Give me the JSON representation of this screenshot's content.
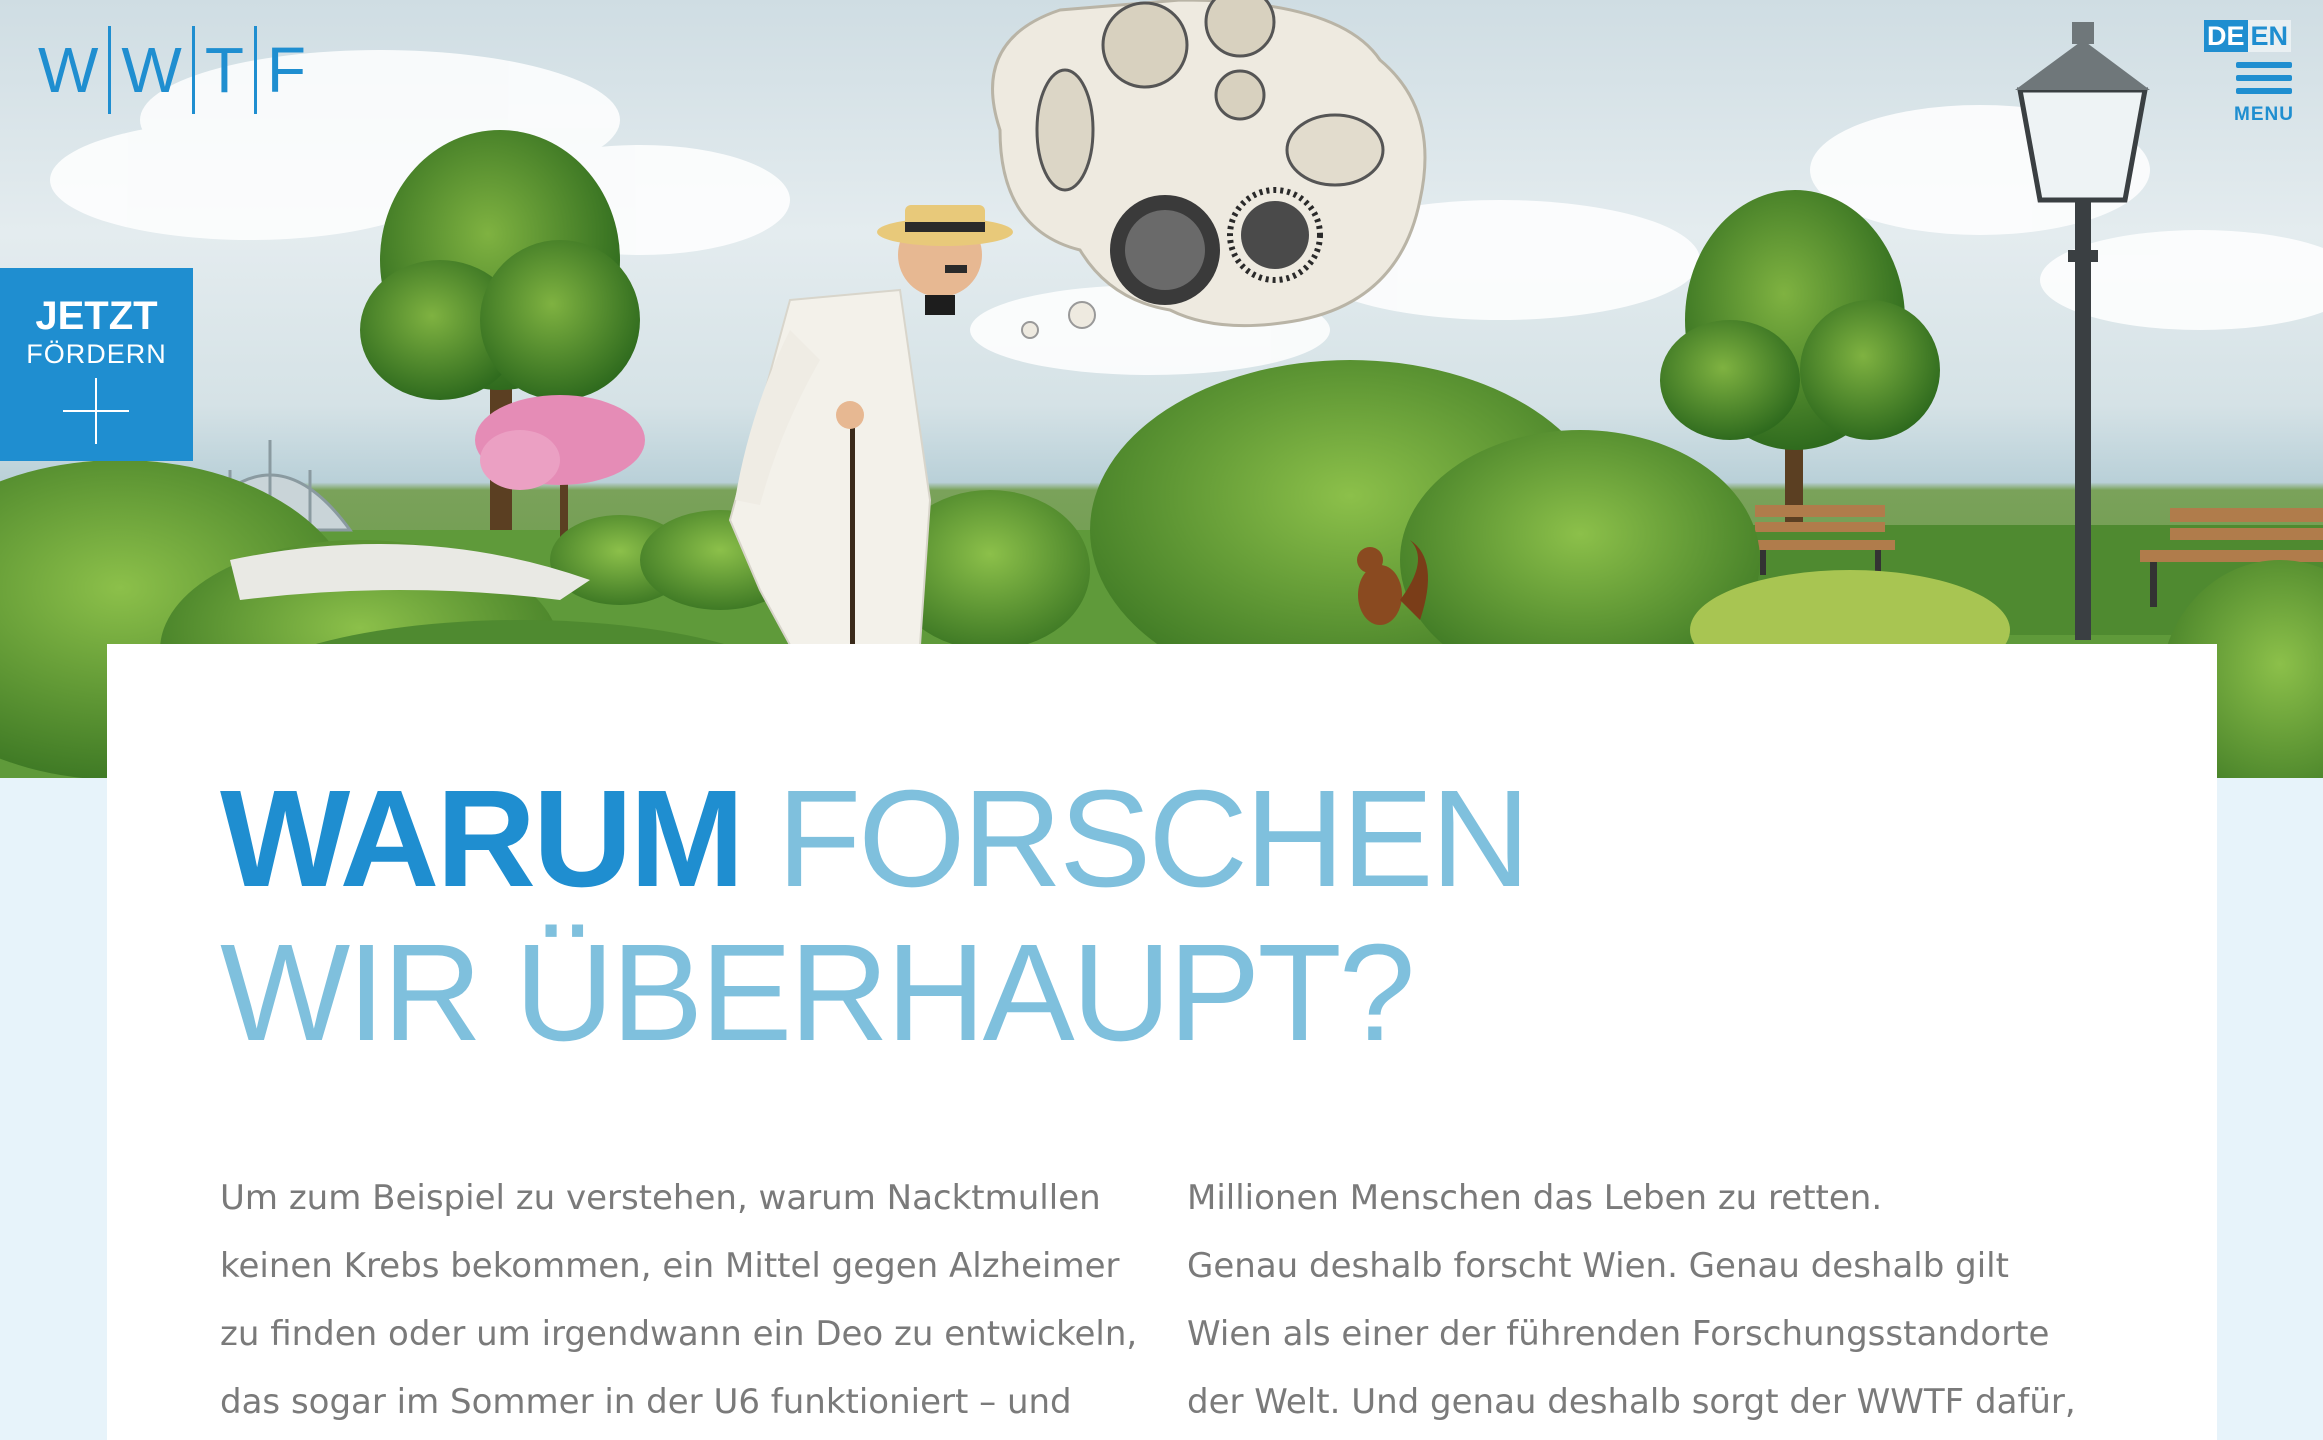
{
  "header": {
    "logo_letters": [
      "W",
      "W",
      "T",
      "F"
    ],
    "lang_de": "DE",
    "lang_en": "EN",
    "menu_label": "MENU"
  },
  "cta": {
    "line1": "JETZT",
    "line2": "FÖRDERN",
    "icon": "plus-icon"
  },
  "main": {
    "heading_strong": "WARUM",
    "heading_light_1": "FORSCHEN",
    "heading_light_2": "WIR ÜBERHAUPT?",
    "col_left": [
      "Um zum Beispiel zu verstehen, warum Nacktmullen",
      "keinen Krebs bekommen, ein Mittel gegen Alzheimer",
      "zu finden oder um irgendwann ein Deo zu entwickeln,",
      "das sogar im Sommer in der U6 funktioniert – und"
    ],
    "col_right": [
      "Millionen Menschen das Leben zu retten.",
      "Genau deshalb forscht Wien. Genau deshalb gilt",
      "Wien als einer der führenden Forschungsstandorte",
      "der Welt. Und genau deshalb sorgt der WWTF dafür,"
    ]
  },
  "colors": {
    "brand_blue": "#1f8ed0",
    "light_blue": "#7fc0dd",
    "body_text": "#7a7a7a",
    "page_bg": "#e7f3fa"
  }
}
